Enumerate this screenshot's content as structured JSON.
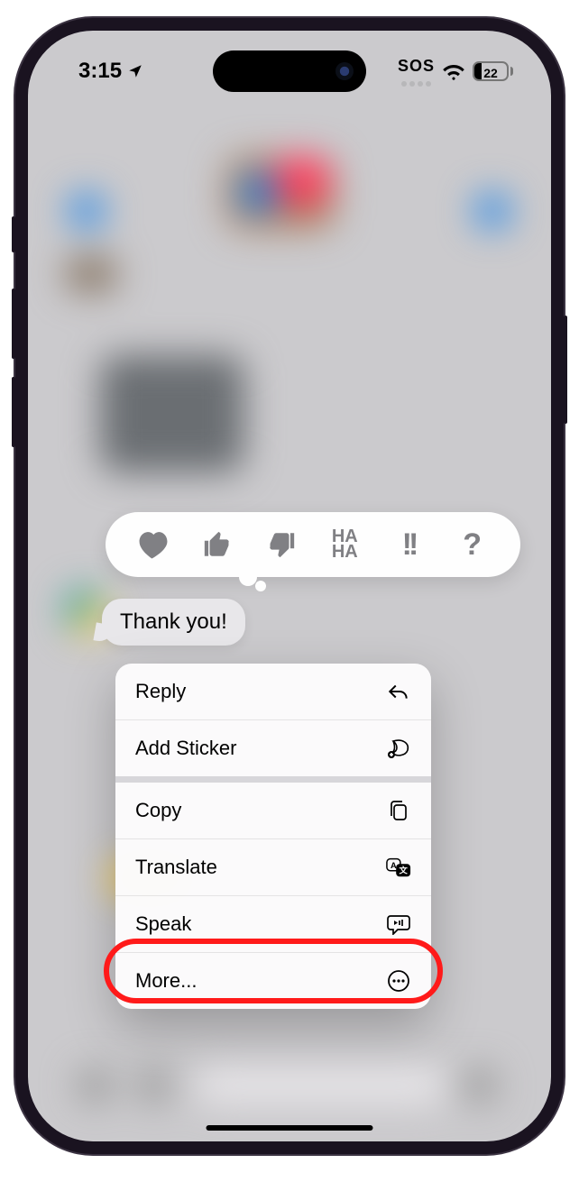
{
  "status": {
    "time": "3:15",
    "sos": "SOS",
    "battery_pct": "22"
  },
  "message": {
    "text": "Thank you!"
  },
  "tapbacks": {
    "haha": "HA\nHA",
    "exclaim": "!!",
    "question": "?"
  },
  "menu": {
    "reply": "Reply",
    "add_sticker": "Add Sticker",
    "copy": "Copy",
    "translate": "Translate",
    "speak": "Speak",
    "more": "More..."
  }
}
